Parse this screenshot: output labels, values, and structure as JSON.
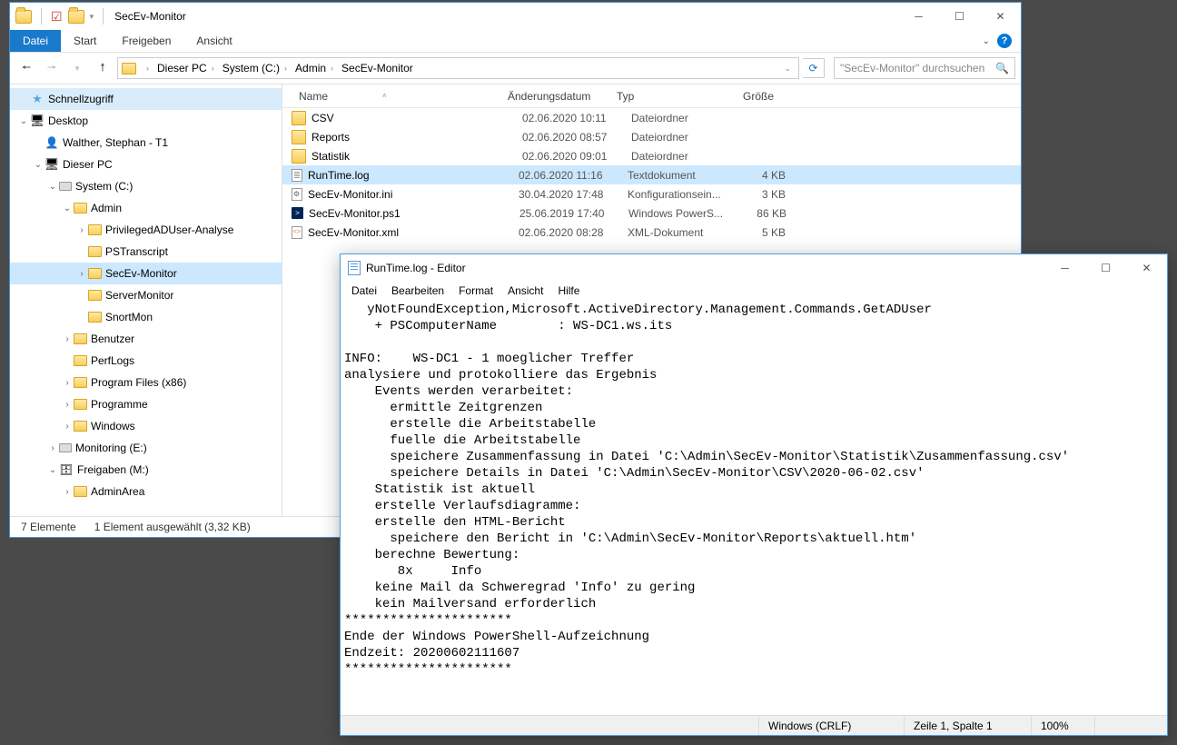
{
  "explorer": {
    "title": "SecEv-Monitor",
    "ribbon": {
      "file": "Datei",
      "start": "Start",
      "share": "Freigeben",
      "view": "Ansicht"
    },
    "breadcrumb": [
      "Dieser PC",
      "System (C:)",
      "Admin",
      "SecEv-Monitor"
    ],
    "search_placeholder": "\"SecEv-Monitor\" durchsuchen",
    "columns": {
      "name": "Name",
      "date": "Änderungsdatum",
      "type": "Typ",
      "size": "Größe"
    },
    "tree": [
      {
        "indent": 0,
        "exp": "",
        "icon": "star",
        "label": "Schnellzugriff",
        "cls": "quick"
      },
      {
        "indent": 0,
        "exp": "v",
        "icon": "pc",
        "label": "Desktop"
      },
      {
        "indent": 1,
        "exp": "",
        "icon": "user",
        "label": "Walther, Stephan - T1"
      },
      {
        "indent": 1,
        "exp": "v",
        "icon": "pc",
        "label": "Dieser PC"
      },
      {
        "indent": 2,
        "exp": "v",
        "icon": "drive",
        "label": "System (C:)"
      },
      {
        "indent": 3,
        "exp": "v",
        "icon": "folder",
        "label": "Admin"
      },
      {
        "indent": 4,
        "exp": ">",
        "icon": "folder",
        "label": "PrivilegedADUser-Analyse"
      },
      {
        "indent": 4,
        "exp": "",
        "icon": "folder",
        "label": "PSTranscript"
      },
      {
        "indent": 4,
        "exp": ">",
        "icon": "folder",
        "label": "SecEv-Monitor",
        "sel": true
      },
      {
        "indent": 4,
        "exp": "",
        "icon": "folder",
        "label": "ServerMonitor"
      },
      {
        "indent": 4,
        "exp": "",
        "icon": "folder",
        "label": "SnortMon"
      },
      {
        "indent": 3,
        "exp": ">",
        "icon": "folder",
        "label": "Benutzer"
      },
      {
        "indent": 3,
        "exp": "",
        "icon": "folder",
        "label": "PerfLogs"
      },
      {
        "indent": 3,
        "exp": ">",
        "icon": "folder",
        "label": "Program Files (x86)"
      },
      {
        "indent": 3,
        "exp": ">",
        "icon": "folder",
        "label": "Programme"
      },
      {
        "indent": 3,
        "exp": ">",
        "icon": "folder",
        "label": "Windows"
      },
      {
        "indent": 2,
        "exp": ">",
        "icon": "drive",
        "label": "Monitoring (E:)"
      },
      {
        "indent": 2,
        "exp": "v",
        "icon": "net",
        "label": "Freigaben (M:)"
      },
      {
        "indent": 3,
        "exp": ">",
        "icon": "folder",
        "label": "AdminArea"
      }
    ],
    "files": [
      {
        "icon": "folder",
        "name": "CSV",
        "date": "02.06.2020 10:11",
        "type": "Dateiordner",
        "size": ""
      },
      {
        "icon": "folder",
        "name": "Reports",
        "date": "02.06.2020 08:57",
        "type": "Dateiordner",
        "size": ""
      },
      {
        "icon": "folder",
        "name": "Statistik",
        "date": "02.06.2020 09:01",
        "type": "Dateiordner",
        "size": ""
      },
      {
        "icon": "txt",
        "name": "RunTime.log",
        "date": "02.06.2020 11:16",
        "type": "Textdokument",
        "size": "4 KB",
        "sel": true
      },
      {
        "icon": "ini",
        "name": "SecEv-Monitor.ini",
        "date": "30.04.2020 17:48",
        "type": "Konfigurationsein...",
        "size": "3 KB"
      },
      {
        "icon": "ps1",
        "name": "SecEv-Monitor.ps1",
        "date": "25.06.2019 17:40",
        "type": "Windows PowerS...",
        "size": "86 KB"
      },
      {
        "icon": "xml",
        "name": "SecEv-Monitor.xml",
        "date": "02.06.2020 08:28",
        "type": "XML-Dokument",
        "size": "5 KB"
      }
    ],
    "status": {
      "count": "7 Elemente",
      "selection": "1 Element ausgewählt (3,32 KB)"
    }
  },
  "notepad": {
    "title": "RunTime.log - Editor",
    "menu": {
      "file": "Datei",
      "edit": "Bearbeiten",
      "format": "Format",
      "view": "Ansicht",
      "help": "Hilfe"
    },
    "text": "   yNotFoundException,Microsoft.ActiveDirectory.Management.Commands.GetADUser\n    + PSComputerName        : WS-DC1.ws.its\n \nINFO:    WS-DC1 - 1 moeglicher Treffer\nanalysiere und protokolliere das Ergebnis\n    Events werden verarbeitet:\n      ermittle Zeitgrenzen\n      erstelle die Arbeitstabelle\n      fuelle die Arbeitstabelle\n      speichere Zusammenfassung in Datei 'C:\\Admin\\SecEv-Monitor\\Statistik\\Zusammenfassung.csv'\n      speichere Details in Datei 'C:\\Admin\\SecEv-Monitor\\CSV\\2020-06-02.csv'\n    Statistik ist aktuell\n    erstelle Verlaufsdiagramme:\n    erstelle den HTML-Bericht\n      speichere den Bericht in 'C:\\Admin\\SecEv-Monitor\\Reports\\aktuell.htm'\n    berechne Bewertung:\n       8x     Info\n    keine Mail da Schweregrad 'Info' zu gering\n    kein Mailversand erforderlich\n**********************\nEnde der Windows PowerShell-Aufzeichnung\nEndzeit: 20200602111607\n**********************",
    "status": {
      "encoding": "Windows (CRLF)",
      "pos": "Zeile 1, Spalte 1",
      "zoom": "100%"
    }
  }
}
